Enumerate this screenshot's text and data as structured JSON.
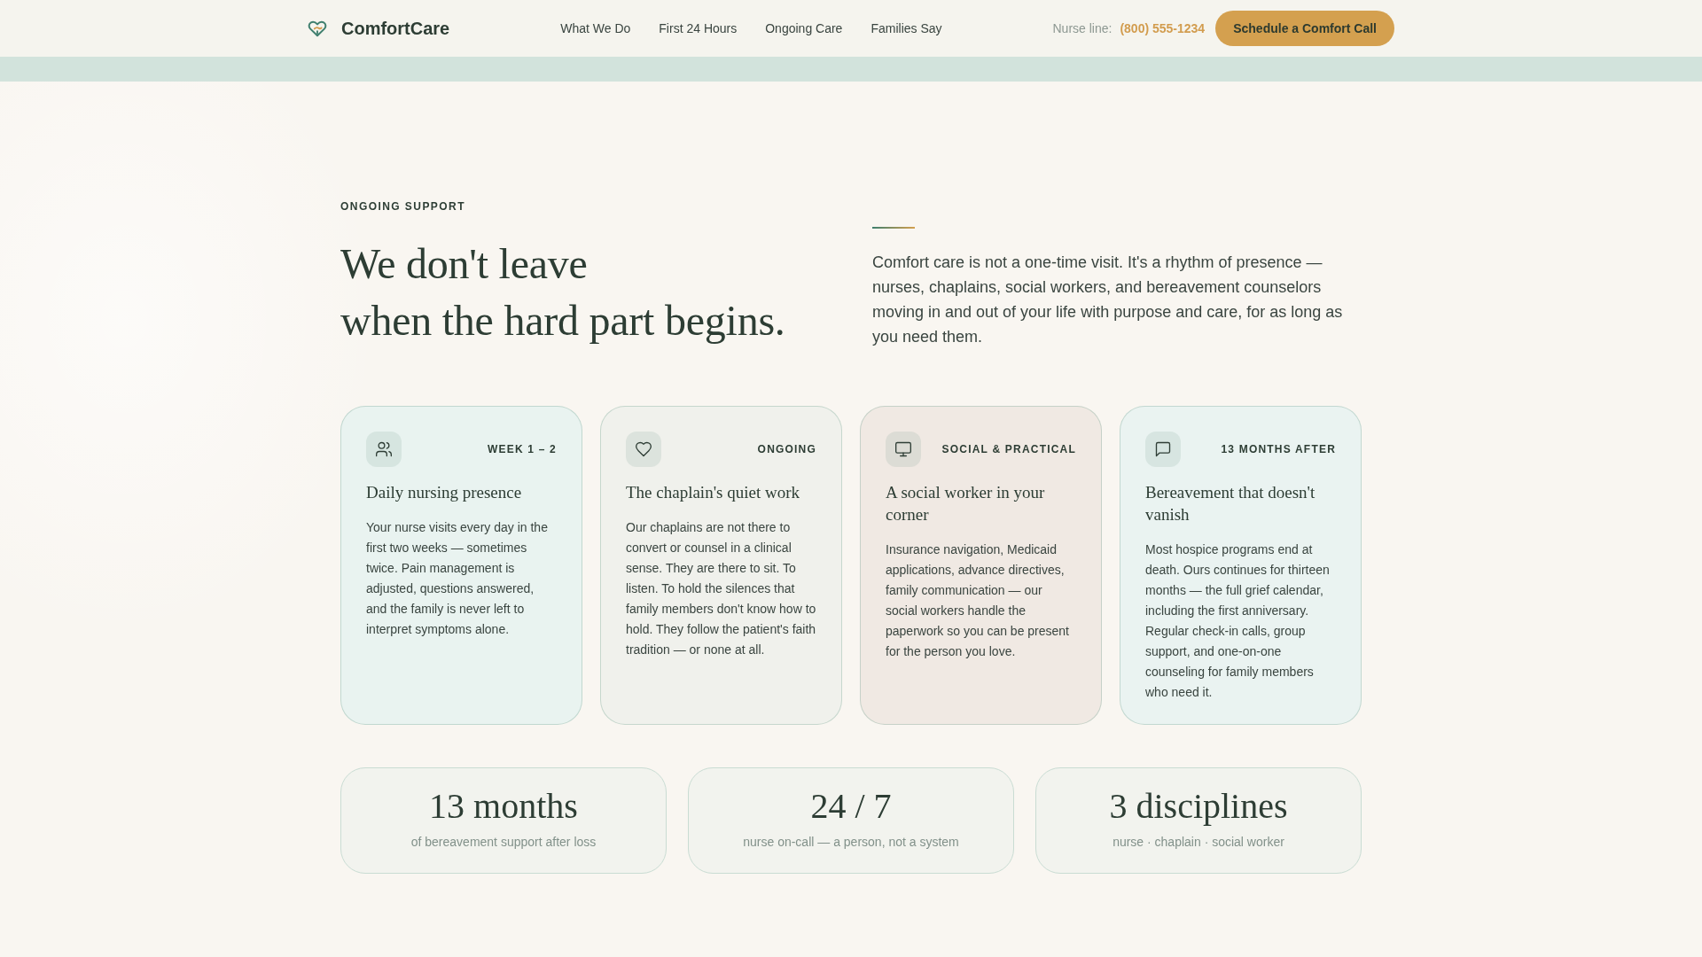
{
  "header": {
    "brand": "ComfortCare",
    "nav": [
      "What We Do",
      "First 24 Hours",
      "Ongoing Care",
      "Families Say"
    ],
    "nurse_line": {
      "label": "Nurse line:",
      "phone": "(800) 555-1234"
    },
    "cta": "Schedule a Comfort Call"
  },
  "intro": {
    "eyebrow": "ONGOING SUPPORT",
    "heading": [
      "We don't leave",
      "when the hard part begins."
    ],
    "lead": "Comfort care is not a one-time visit. It's a rhythm of presence — nurses, chaplains, social workers, and bereavement counselors moving in and out of your life with purpose and care, for as long as you need them."
  },
  "cards": [
    {
      "tag": "WEEK 1 – 2",
      "title": "Daily nursing presence",
      "body": "Your nurse visits every day in the first two weeks — sometimes twice. Pain management is adjusted, questions answered, and the family is never left to interpret symptoms alone.",
      "color": "#e9f3f0"
    },
    {
      "tag": "ONGOING",
      "title": "The chaplain's quiet work",
      "body": "Our chaplains are not there to convert or counsel in a clinical sense. They are there to sit. To listen. To hold the silences that family members don't know how to hold. They follow the patient's faith tradition — or none at all.",
      "color": "#f0f1ec"
    },
    {
      "tag": "SOCIAL & PRACTICAL",
      "title": "A social worker in your corner",
      "body": "Insurance navigation, Medicaid applications, advance directives, family communication — our social workers handle the paperwork so you can be present for the person you love.",
      "color": "#f0e9e3"
    },
    {
      "tag": "13 MONTHS AFTER",
      "title": "Bereavement that doesn't vanish",
      "body": "Most hospice programs end at death. Ours continues for thirteen months — the full grief calendar, including the first anniversary. Regular check-in calls, group support, and one-on-one counseling for family members who need it.",
      "color": "#eaf3f1"
    }
  ],
  "stats": [
    {
      "value": "13 months",
      "caption": "of bereavement support after loss"
    },
    {
      "value": "24 / 7",
      "caption": "nurse on-call — a person, not a system"
    },
    {
      "value": "3 disciplines",
      "caption": "nurse · chaplain · social worker"
    }
  ]
}
